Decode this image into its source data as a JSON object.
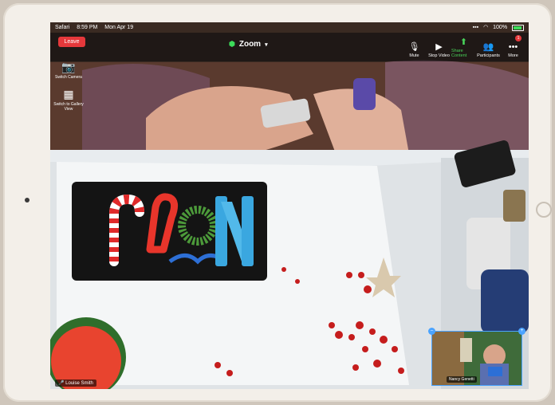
{
  "statusbar": {
    "app": "Safari",
    "time": "8:59 PM",
    "date": "Mon Apr 19",
    "battery": "100%"
  },
  "meeting": {
    "leave_label": "Leave",
    "title": "Zoom",
    "title_icon": "shield-icon",
    "dropdown_icon": "chevron-down-icon"
  },
  "toolbar": [
    {
      "label": "Mute",
      "icon": "microphone-icon"
    },
    {
      "label": "Stop Video",
      "icon": "video-camera-icon"
    },
    {
      "label": "Share Content",
      "icon": "share-screen-icon"
    },
    {
      "label": "Participants",
      "icon": "participants-icon"
    },
    {
      "label": "More",
      "icon": "more-icon",
      "badge": "1"
    }
  ],
  "side_controls": {
    "switch_camera": "Switch Camera",
    "gallery_view": "Switch to Gallery View"
  },
  "main_video": {
    "participant_name": "Louise Smith"
  },
  "self_view": {
    "participant_name": "Nancy Genetti"
  },
  "colors": {
    "leave_red": "#e5383b",
    "zoom_green": "#49d35a",
    "selfview_border": "#4aa3ff"
  }
}
